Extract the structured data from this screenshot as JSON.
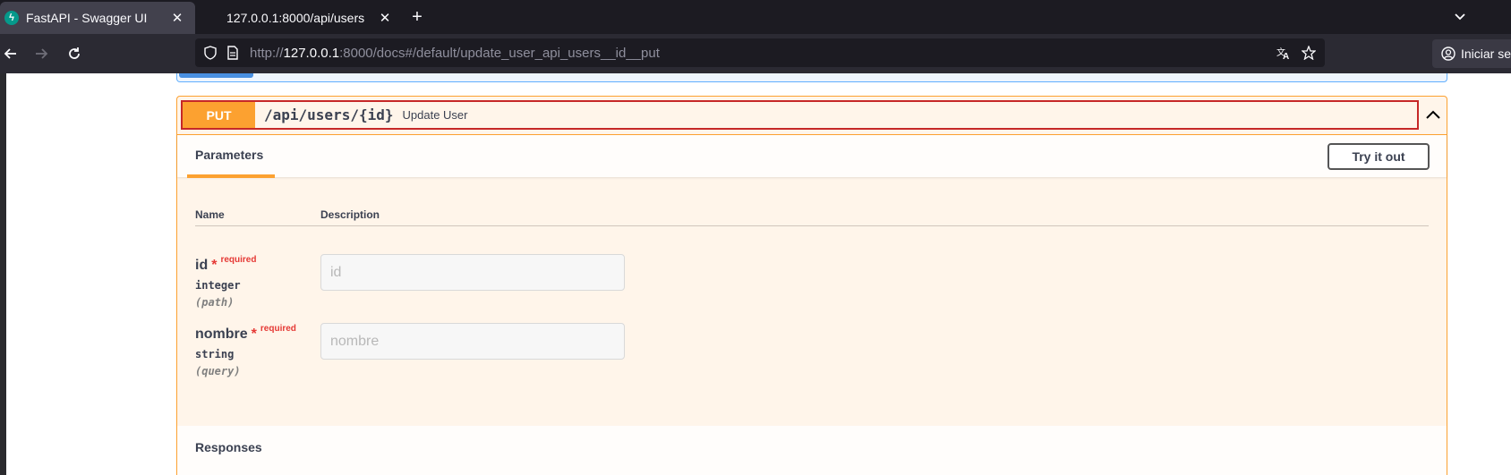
{
  "browser": {
    "tabs": [
      {
        "title": "FastAPI - Swagger UI",
        "active": true
      },
      {
        "title": "127.0.0.1:8000/api/users",
        "active": false
      }
    ],
    "url_prefix": "http://",
    "url_host": "127.0.0.1",
    "url_rest": ":8000/docs#/default/update_user_api_users__id__put",
    "profile_label": "Iniciar se"
  },
  "operation": {
    "method": "PUT",
    "path": "/api/users/{id}",
    "summary": "Update User",
    "method_color": "#fca130"
  },
  "parameters": {
    "tab_label": "Parameters",
    "try_it_out": "Try it out",
    "col_name": "Name",
    "col_description": "Description",
    "items": [
      {
        "name": "id",
        "star": "*",
        "required": "required",
        "type": "integer",
        "in": "(path)",
        "placeholder": "id"
      },
      {
        "name": "nombre",
        "star": "*",
        "required": "required",
        "type": "string",
        "in": "(query)",
        "placeholder": "nombre"
      }
    ]
  },
  "responses": {
    "title": "Responses"
  }
}
